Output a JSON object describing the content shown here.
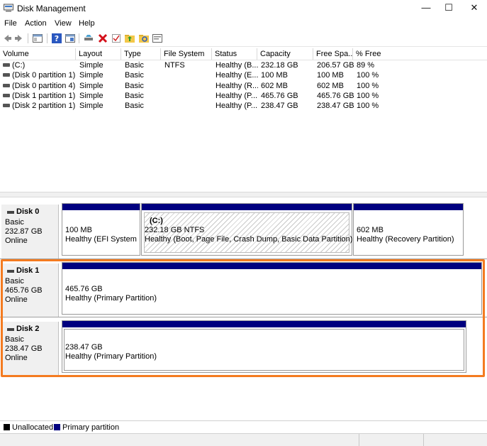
{
  "window": {
    "title": "Disk Management",
    "minimize": "—",
    "maximize": "☐",
    "close": "✕"
  },
  "menu": [
    "File",
    "Action",
    "View",
    "Help"
  ],
  "toolbar_icons": [
    "back-icon",
    "forward-icon",
    "console-tree-icon",
    "help-icon",
    "properties-icon",
    "connect-drive-icon",
    "delete-icon",
    "check-icon",
    "folder-up-icon",
    "folder-search-icon",
    "console-icon"
  ],
  "volume_list": {
    "columns": [
      "Volume",
      "Layout",
      "Type",
      "File System",
      "Status",
      "Capacity",
      "Free Spa...",
      "% Free"
    ],
    "rows": [
      [
        "(C:)",
        "Simple",
        "Basic",
        "NTFS",
        "Healthy (B...",
        "232.18 GB",
        "206.57 GB",
        "89 %"
      ],
      [
        "(Disk 0 partition 1)",
        "Simple",
        "Basic",
        "",
        "Healthy (E...",
        "100 MB",
        "100 MB",
        "100 %"
      ],
      [
        "(Disk 0 partition 4)",
        "Simple",
        "Basic",
        "",
        "Healthy (R...",
        "602 MB",
        "602 MB",
        "100 %"
      ],
      [
        "(Disk 1 partition 1)",
        "Simple",
        "Basic",
        "",
        "Healthy (P...",
        "465.76 GB",
        "465.76 GB",
        "100 %"
      ],
      [
        "(Disk 2 partition 1)",
        "Simple",
        "Basic",
        "",
        "Healthy (P...",
        "238.47 GB",
        "238.47 GB",
        "100 %"
      ]
    ]
  },
  "disks": [
    {
      "name": "Disk 0",
      "type": "Basic",
      "size": "232.87 GB",
      "state": "Online",
      "partitions": [
        {
          "label": "",
          "line1": "100 MB",
          "line2": "Healthy (EFI System Pa"
        },
        {
          "label": "(C:)",
          "line1": "232.18 GB NTFS",
          "line2": "Healthy (Boot, Page File, Crash Dump, Basic Data Partition)"
        },
        {
          "label": "",
          "line1": "602 MB",
          "line2": "Healthy (Recovery Partition)"
        }
      ]
    },
    {
      "name": "Disk 1",
      "type": "Basic",
      "size": "465.76 GB",
      "state": "Online",
      "partitions": [
        {
          "label": "",
          "line1": "465.76 GB",
          "line2": "Healthy (Primary Partition)"
        }
      ]
    },
    {
      "name": "Disk 2",
      "type": "Basic",
      "size": "238.47 GB",
      "state": "Online",
      "partitions": [
        {
          "label": "",
          "line1": "238.47 GB",
          "line2": "Healthy (Primary Partition)"
        }
      ]
    }
  ],
  "legend": [
    {
      "label": "Unallocated",
      "color": "#000000"
    },
    {
      "label": "Primary partition",
      "color": "#00007f"
    }
  ],
  "colors": {
    "partition_bar": "#00007f",
    "highlight": "#f47b20"
  }
}
